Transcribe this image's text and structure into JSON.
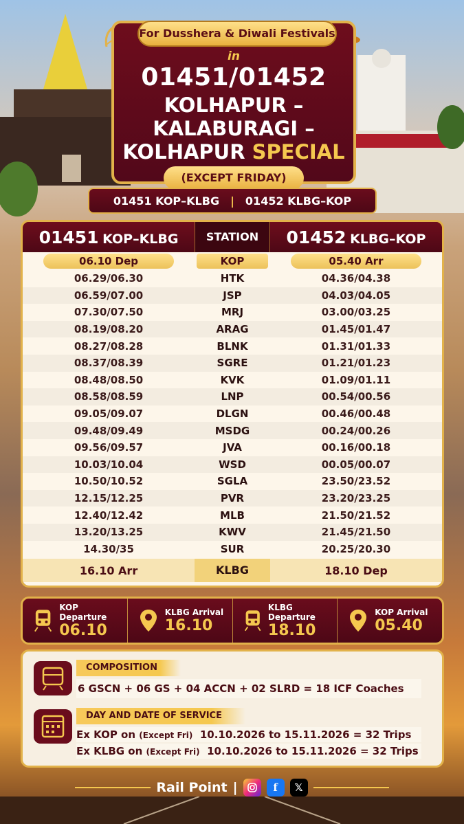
{
  "header": {
    "festival": "For Dusshera & Diwali Festivals",
    "in": "in",
    "train_numbers": "01451/01452",
    "route_line1": "KOLHAPUR –",
    "route_line2": "KALABURAGI –",
    "route_line3a": "KOLHAPUR",
    "route_line3b": "SPECIAL",
    "except": "(EXCEPT FRIDAY)"
  },
  "subbar": {
    "left": "01451 KOP–KLBG",
    "sep": "|",
    "right": "01452 KLBG–KOP"
  },
  "table": {
    "col1_num": "01451",
    "col1_route": "KOP–KLBG",
    "col2": "STATION",
    "col3_num": "01452",
    "col3_route": "KLBG–KOP",
    "first": {
      "down": "06.10 Dep",
      "station": "KOP",
      "up": "05.40 Arr"
    },
    "rows": [
      {
        "down": "06.29/06.30",
        "station": "HTK",
        "up": "04.36/04.38"
      },
      {
        "down": "06.59/07.00",
        "station": "JSP",
        "up": "04.03/04.05"
      },
      {
        "down": "07.30/07.50",
        "station": "MRJ",
        "up": "03.00/03.25"
      },
      {
        "down": "08.19/08.20",
        "station": "ARAG",
        "up": "01.45/01.47"
      },
      {
        "down": "08.27/08.28",
        "station": "BLNK",
        "up": "01.31/01.33"
      },
      {
        "down": "08.37/08.39",
        "station": "SGRE",
        "up": "01.21/01.23"
      },
      {
        "down": "08.48/08.50",
        "station": "KVK",
        "up": "01.09/01.11"
      },
      {
        "down": "08.58/08.59",
        "station": "LNP",
        "up": "00.54/00.56"
      },
      {
        "down": "09.05/09.07",
        "station": "DLGN",
        "up": "00.46/00.48"
      },
      {
        "down": "09.48/09.49",
        "station": "MSDG",
        "up": "00.24/00.26"
      },
      {
        "down": "09.56/09.57",
        "station": "JVA",
        "up": "00.16/00.18"
      },
      {
        "down": "10.03/10.04",
        "station": "WSD",
        "up": "00.05/00.07"
      },
      {
        "down": "10.50/10.52",
        "station": "SGLA",
        "up": "23.50/23.52"
      },
      {
        "down": "12.15/12.25",
        "station": "PVR",
        "up": "23.20/23.25"
      },
      {
        "down": "12.40/12.42",
        "station": "MLB",
        "up": "21.50/21.52"
      },
      {
        "down": "13.20/13.25",
        "station": "KWV",
        "up": "21.45/21.50"
      },
      {
        "down": "14.30/35",
        "station": "SUR",
        "up": "20.25/20.30"
      }
    ],
    "last": {
      "down": "16.10 Arr",
      "station": "KLBG",
      "up": "18.10 Dep"
    }
  },
  "summary": [
    {
      "label": "KOP Departure",
      "value": "06.10",
      "icon": "train-icon"
    },
    {
      "label": "KLBG Arrival",
      "value": "16.10",
      "icon": "location-pin-icon"
    },
    {
      "label": "KLBG Departure",
      "value": "18.10",
      "icon": "train-icon"
    },
    {
      "label": "KOP Arrival",
      "value": "05.40",
      "icon": "location-pin-icon"
    }
  ],
  "composition": {
    "title": "COMPOSITION",
    "text": "6 GSCN + 06 GS + 04 ACCN + 02 SLRD = 18 ICF Coaches"
  },
  "service": {
    "title": "DAY AND DATE OF SERVICE",
    "line1_main": "Ex KOP on",
    "line1_note": "(Except Fri)",
    "line1_dates": "10.10.2026 to 15.11.2026 = 32 Trips",
    "line2_main": "Ex KLBG on",
    "line2_note": "(Except Fri)",
    "line2_dates": "10.10.2026 to 15.11.2026 = 32 Trips"
  },
  "footer": {
    "brand": "Rail Point",
    "sep": "|",
    "instagram": "instagram-icon",
    "facebook": "facebook-icon",
    "x": "x-icon"
  },
  "colors": {
    "maroon": "#6a0c1c",
    "gold": "#e2b24a",
    "gold_text": "#f5c84f",
    "cream": "#fdf6ea"
  }
}
